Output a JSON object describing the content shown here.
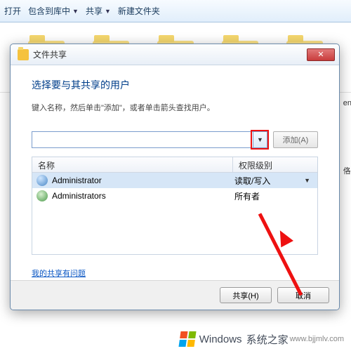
{
  "toolbar": {
    "open": "打开",
    "include": "包含到库中",
    "share": "共享",
    "newfolder": "新建文件夹"
  },
  "dialog": {
    "title": "文件共享",
    "heading": "选择要与其共享的用户",
    "subtext": "键入名称，然后单击\"添加\"，或者单击箭头查找用户。",
    "add_label": "添加(A)",
    "columns": {
      "name": "名称",
      "perm": "权限级别"
    },
    "rows": [
      {
        "name": "Administrator",
        "perm": "读取/写入",
        "type": "user",
        "selected": true,
        "caret": true
      },
      {
        "name": "Administrators",
        "perm": "所有者",
        "type": "group",
        "selected": false,
        "caret": false
      }
    ],
    "help_link": "我的共享有问题",
    "share_btn": "共享(H)",
    "cancel_btn": "取消"
  },
  "side_labels": {
    "a": "en",
    "b": "佫"
  },
  "watermark": {
    "brand": "Windows",
    "site": "系统之家",
    "url": "www.bjjmlv.com"
  }
}
